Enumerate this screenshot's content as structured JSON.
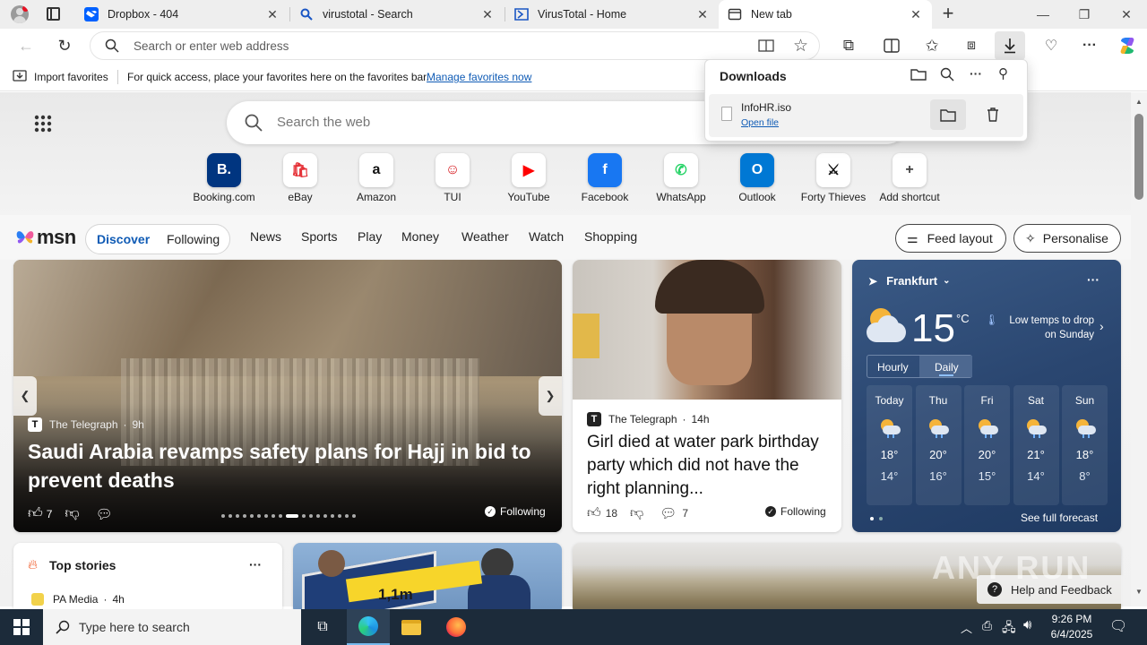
{
  "tabs": [
    {
      "title": "Dropbox - 404",
      "icon": "dropbox-icon"
    },
    {
      "title": "virustotal - Search",
      "icon": "search-icon"
    },
    {
      "title": "VirusTotal - Home",
      "icon": "virustotal-icon"
    },
    {
      "title": "New tab",
      "icon": "newtab-icon"
    }
  ],
  "address": {
    "placeholder": "Search or enter web address"
  },
  "favbar": {
    "import": "Import favorites",
    "hint": "For quick access, place your favorites here on the favorites bar.",
    "manage": "Manage favorites now"
  },
  "downloads": {
    "title": "Downloads",
    "file": "InfoHR.iso",
    "open": "Open file"
  },
  "search": {
    "placeholder": "Search the web"
  },
  "shortcuts": [
    {
      "label": "Booking.com",
      "glyph": "B.",
      "color": "#003580",
      "fg": "#ffffff"
    },
    {
      "label": "eBay",
      "glyph": "🛍",
      "color": "#ffffff",
      "fg": "#e53238"
    },
    {
      "label": "Amazon",
      "glyph": "a",
      "color": "#ffffff",
      "fg": "#111111"
    },
    {
      "label": "TUI",
      "glyph": "☺",
      "color": "#ffffff",
      "fg": "#d40e14"
    },
    {
      "label": "YouTube",
      "glyph": "▶",
      "color": "#ffffff",
      "fg": "#ff0000"
    },
    {
      "label": "Facebook",
      "glyph": "f",
      "color": "#1877f2",
      "fg": "#ffffff"
    },
    {
      "label": "WhatsApp",
      "glyph": "✆",
      "color": "#ffffff",
      "fg": "#25d366"
    },
    {
      "label": "Outlook",
      "glyph": "O",
      "color": "#0078d4",
      "fg": "#ffffff"
    },
    {
      "label": "Forty Thieves",
      "glyph": "⚔",
      "color": "#ffffff",
      "fg": "#111111"
    },
    {
      "label": "Add shortcut",
      "glyph": "+",
      "color": "#ffffff",
      "fg": "#444444"
    }
  ],
  "msn": {
    "logo": "msn",
    "discover": "Discover",
    "following": "Following",
    "nav": [
      "News",
      "Sports",
      "Play",
      "Money",
      "Weather",
      "Watch",
      "Shopping"
    ],
    "feed_layout": "Feed layout",
    "personalise": "Personalise"
  },
  "hero": {
    "source": "The Telegraph",
    "age": "9h",
    "headline": "Saudi Arabia revamps safety plans for Hajj in bid to prevent deaths",
    "likes": "7",
    "following": "Following"
  },
  "card2": {
    "source": "The Telegraph",
    "age": "14h",
    "headline": "Girl died at water park birthday party which did not have the right planning...",
    "likes": "18",
    "comments": "7",
    "following": "Following"
  },
  "weather": {
    "city": "Frankfurt",
    "temp": "15",
    "unit": "°C",
    "note": "Low temps to drop on Sunday",
    "tab_hourly": "Hourly",
    "tab_daily": "Daily",
    "days": [
      {
        "d": "Today",
        "hi": "18°",
        "lo": "14°"
      },
      {
        "d": "Thu",
        "hi": "20°",
        "lo": "16°"
      },
      {
        "d": "Fri",
        "hi": "20°",
        "lo": "15°"
      },
      {
        "d": "Sat",
        "hi": "21°",
        "lo": "14°"
      },
      {
        "d": "Sun",
        "hi": "18°",
        "lo": "8°"
      }
    ],
    "forecast": "See full forecast"
  },
  "topstories": {
    "title": "Top stories",
    "source": "PA Media",
    "age": "4h"
  },
  "solar": {
    "caption": "1,1m"
  },
  "help": "Help and Feedback",
  "taskbar": {
    "search": "Type here to search",
    "time": "9:26 PM",
    "date": "6/4/2025"
  },
  "watermark": "ANY RUN"
}
